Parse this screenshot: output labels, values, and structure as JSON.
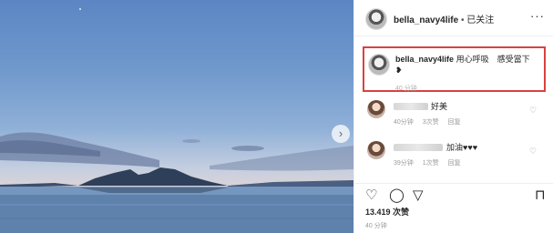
{
  "post": {
    "username": "bella_navy4life",
    "separator": "•",
    "follow_status": "已关注",
    "more_label": "···",
    "next_arrow": "›"
  },
  "caption": {
    "username": "bella_navy4life",
    "text": "用心呼吸　感受當下",
    "emoji": "❥",
    "time": "40 分钟"
  },
  "comments": [
    {
      "text": "好美",
      "meta": "40分钟 3次赞 回复"
    },
    {
      "text": "加油♥♥♥",
      "meta": "39分钟 1次赞 回复"
    }
  ],
  "actions": {
    "like_icon": "♡",
    "comment_icon": "◯",
    "share_icon": "▽",
    "save_icon": "⊓"
  },
  "likes": "13.419 次赞",
  "post_time": "40 分钟"
}
